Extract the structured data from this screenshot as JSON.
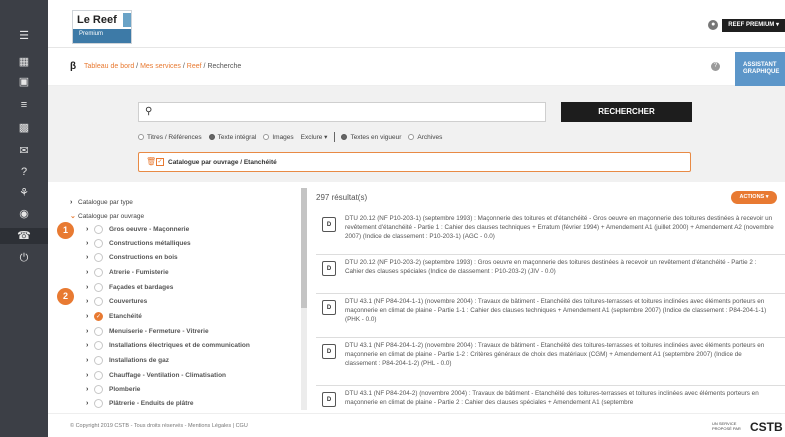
{
  "colors": {
    "accent": "#e87a32",
    "sidebar": "#3c3f46",
    "primary_button": "#1d1d1d"
  },
  "sidebar": {
    "icons": [
      "menu-icon",
      "dashboard-icon",
      "briefcase-icon",
      "list-icon",
      "calendar-icon",
      "mail-icon",
      "help-icon",
      "basket-icon",
      "user-icon",
      "phone-icon",
      "power-icon"
    ]
  },
  "header": {
    "logo_title": "Le Reef",
    "logo_subtitle": "Premium",
    "user_button": "REEF PREMIUM"
  },
  "breadcrumb": {
    "items": [
      "Tableau de bord",
      "Mes services",
      "Reef"
    ],
    "current": "Recherche",
    "separator": "/"
  },
  "assistant": {
    "line1": "ASSISTANT",
    "line2": "GRAPHIQUE"
  },
  "search": {
    "value": "",
    "placeholder": "",
    "button_label": "RECHERCHER",
    "options": [
      {
        "label": "Titres / Références",
        "selected": false
      },
      {
        "label": "Texte intégral",
        "selected": true
      },
      {
        "label": "Images",
        "selected": false
      }
    ],
    "exclude_label": "Exclure",
    "status_options": [
      {
        "label": "Textes en vigueur",
        "selected": true
      },
      {
        "label": "Archives",
        "selected": false
      }
    ],
    "active_filter": "Catalogue par ouvrage / Etanchéité"
  },
  "tree": {
    "roots": [
      {
        "label": "Catalogue par type",
        "expanded": false
      },
      {
        "label": "Catalogue par ouvrage",
        "expanded": true
      }
    ],
    "children": [
      {
        "label": "Gros oeuvre - Maçonnerie",
        "checked": false
      },
      {
        "label": "Constructions métalliques",
        "checked": false
      },
      {
        "label": "Constructions en bois",
        "checked": false
      },
      {
        "label": "Atrerie - Fumisterie",
        "checked": false
      },
      {
        "label": "Façades et bardages",
        "checked": false
      },
      {
        "label": "Couvertures",
        "checked": false
      },
      {
        "label": "Etanchéité",
        "checked": true
      },
      {
        "label": "Menuiserie - Fermeture - Vitrerie",
        "checked": false
      },
      {
        "label": "Installations électriques et de communication",
        "checked": false
      },
      {
        "label": "Installations de gaz",
        "checked": false
      },
      {
        "label": "Chauffage - Ventilation - Climatisation",
        "checked": false
      },
      {
        "label": "Plomberie",
        "checked": false
      },
      {
        "label": "Plâtrerie - Enduits de plâtre",
        "checked": false
      }
    ]
  },
  "badges": [
    "1",
    "2"
  ],
  "results": {
    "count_label": "297 résultat(s)",
    "actions_label": "ACTIONS",
    "items": [
      {
        "text": "DTU 20.12 (NF P10-203-1) (septembre 1993) : Maçonnerie des toitures et d'étanchéité - Gros oeuvre en maçonnerie des toitures destinées à recevoir un revêtement d'étanchéité - Partie 1 : Cahier des clauses techniques + Erratum (février 1994) + Amendement A1 (juillet 2000) + Amendement A2 (novembre 2007) (Indice de classement : P10-203-1) (AGC - 0.0)"
      },
      {
        "text": "DTU 20.12 (NF P10-203-2) (septembre 1993) : Gros oeuvre en maçonnerie des toitures destinées à recevoir un revêtement d'étanchéité - Partie 2 : Cahier des clauses spéciales (Indice de classement : P10-203-2) (JIV - 0.0)"
      },
      {
        "text": "DTU 43.1 (NF P84-204-1-1) (novembre 2004) : Travaux de bâtiment - Etanchéité des toitures-terrasses et toitures inclinées avec éléments porteurs en maçonnerie en climat de plaine - Partie 1-1 : Cahier des clauses techniques + Amendement A1 (septembre 2007) (Indice de classement : P84-204-1-1) (PHK - 0.0)"
      },
      {
        "text": "DTU 43.1 (NF P84-204-1-2) (novembre 2004) : Travaux de bâtiment - Etanchéité des toitures-terrasses et toitures inclinées avec éléments porteurs en maçonnerie en climat de plaine - Partie 1-2 : Critères généraux de choix des matériaux (CGM) + Amendement A1 (septembre 2007) (Indice de classement : P84-204-1-2) (PHL - 0.0)"
      },
      {
        "text": "DTU 43.1 (NF P84-204-2) (novembre 2004) : Travaux de bâtiment - Etanchéité des toitures-terrasses et toitures inclinées avec éléments porteurs en maçonnerie en climat de plaine - Partie 2 : Cahier des clauses spéciales + Amendement A1 (septembre"
      }
    ]
  },
  "footer": {
    "copyright": "© Copyright 2019 CSTB - Tous droits réservés - Mentions Légales | CGU",
    "service_line1": "UN SERVICE",
    "service_line2": "PROPOSÉ PAR",
    "brand": "CSTB"
  }
}
